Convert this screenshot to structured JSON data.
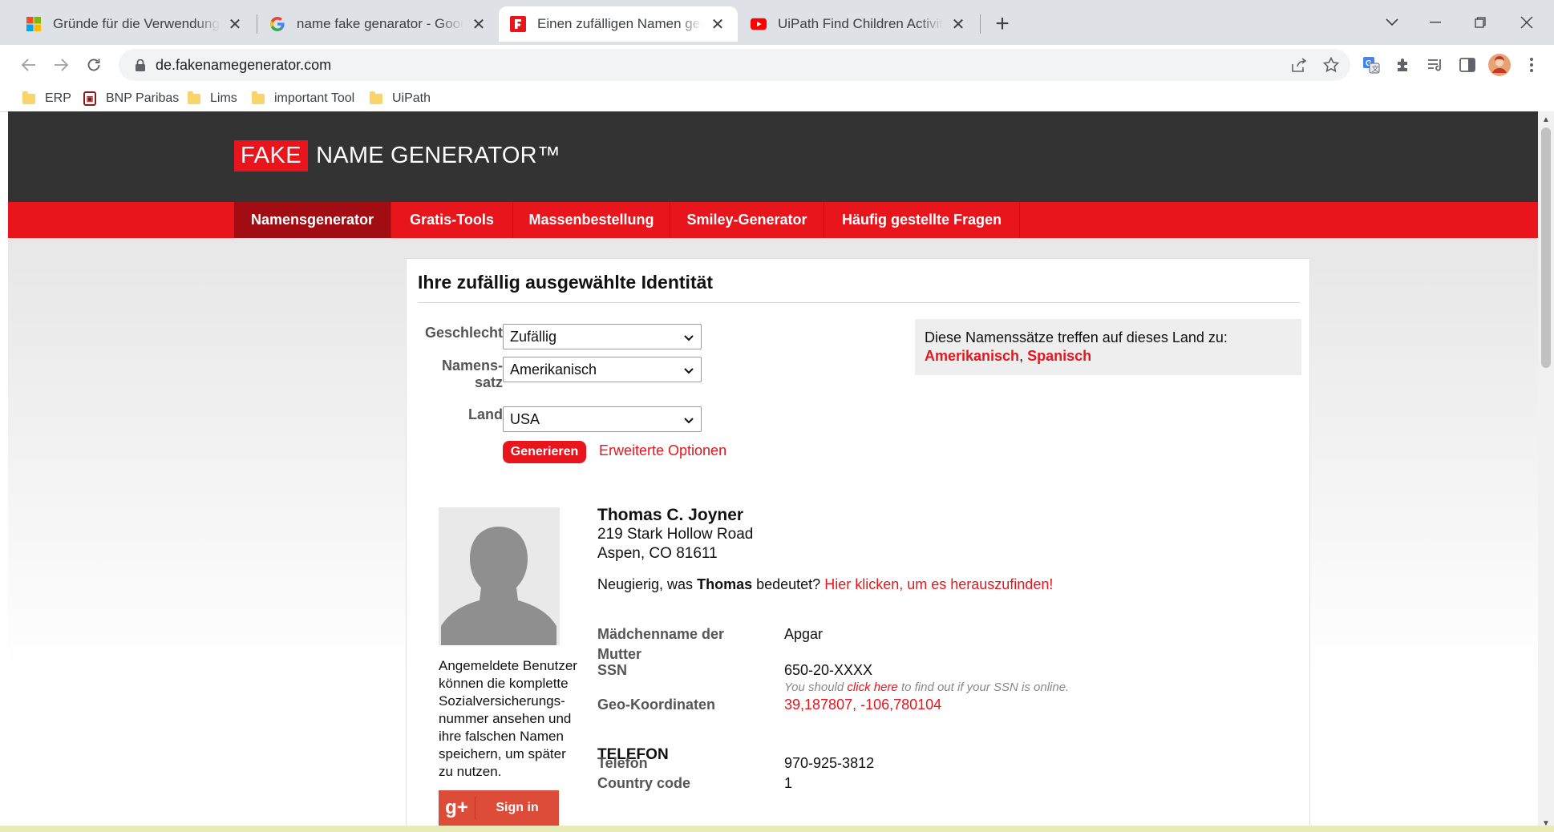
{
  "browser": {
    "tabs": [
      {
        "title": "Gründe für die Verwendung von Fake Namen",
        "icon": "microsoft-icon"
      },
      {
        "title": "name fake genarator - Google Suche",
        "icon": "google-icon"
      },
      {
        "title": "Einen zufälligen Namen generieren",
        "icon": "fakenamegenerator-icon",
        "active": true
      },
      {
        "title": "UiPath Find Children Activity | Selenium",
        "icon": "youtube-icon"
      }
    ],
    "url": "de.fakenamegenerator.com",
    "bookmarks": [
      {
        "label": "ERP",
        "icon": "folder-icon"
      },
      {
        "label": "BNP Paribas",
        "icon": "bnp-icon"
      },
      {
        "label": "Lims",
        "icon": "folder-icon"
      },
      {
        "label": "important Tool",
        "icon": "folder-icon"
      },
      {
        "label": "UiPath",
        "icon": "folder-icon"
      }
    ]
  },
  "site": {
    "logo_fake": "FAKE",
    "logo_rest": "NAME GENERATOR™",
    "nav": [
      "Namensgenerator",
      "Gratis-Tools",
      "Massenbestellung",
      "Smiley-Generator",
      "Häufig gestellte Fragen"
    ]
  },
  "form": {
    "title": "Ihre zufällig ausgewählte Identität",
    "gender_label": "Geschlecht",
    "gender_value": "Zufällig",
    "nameset_label_1": "Namens-",
    "nameset_label_2": "satz",
    "nameset_value": "Amerikanisch",
    "country_label": "Land",
    "country_value": "USA",
    "generate_label": "Generieren",
    "advanced_label": "Erweiterte Optionen"
  },
  "info": {
    "text": "Diese Namenssätze treffen auf dieses Land zu:",
    "link1": "Amerikanisch",
    "sep": ",",
    "link2": "Spanisch"
  },
  "identity": {
    "name": "Thomas C. Joyner",
    "street": "219 Stark Hollow Road",
    "city": "Aspen, CO 81611",
    "curious_pre": "Neugierig, was",
    "curious_name": "Thomas",
    "curious_mid": "bedeutet?",
    "curious_link": "Hier klicken, um es herauszufinden!",
    "avatar_note": "Angemeldete Benutzer können die komplette Sozialversicherungs-nummer ansehen und ihre falschen Namen speichern, um später zu nutzen.",
    "signin": "Sign in",
    "gplus": "g+",
    "maiden_label_1": "Mädchenname der",
    "maiden_label_2": "Mutter",
    "maiden_value": "Apgar",
    "ssn_label": "SSN",
    "ssn_value": "650-20-XXXX",
    "ssn_note_pre": "You should",
    "ssn_note_link": "click here",
    "ssn_note_post": "to find out if your SSN is online.",
    "geo_label": "Geo-Koordinaten",
    "geo_value": "39,187807, -106,780104",
    "phone_section": "TELEFON",
    "phone_label": "Telefon",
    "phone_value": "970-925-3812",
    "cc_label": "Country code",
    "cc_value": "1"
  },
  "colors": {
    "brand_red": "#e8151d",
    "header_dark": "#333333",
    "nav_active": "#a10d12"
  }
}
